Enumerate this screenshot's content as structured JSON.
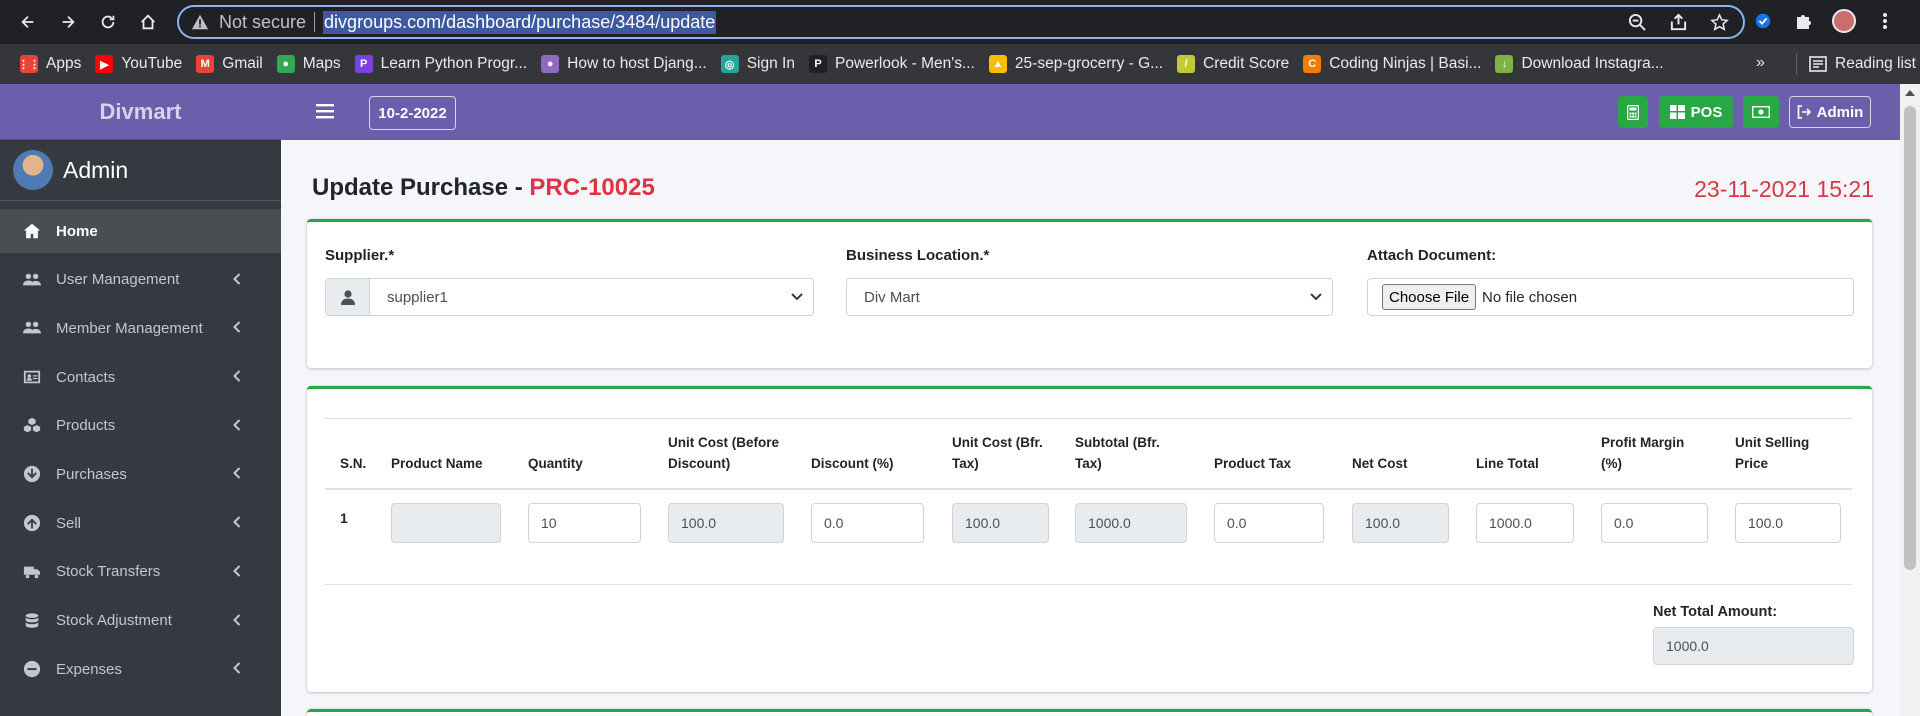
{
  "browser": {
    "not_secure": "Not secure",
    "url": "divgroups.com/dashboard/purchase/3484/update",
    "bookmarks": [
      {
        "label": "Apps",
        "icon": "apps-grid-icon",
        "color": "#ea4335"
      },
      {
        "label": "YouTube",
        "icon": "youtube-icon",
        "color": "#ff0000"
      },
      {
        "label": "Gmail",
        "icon": "gmail-icon",
        "color": "#ea4335"
      },
      {
        "label": "Maps",
        "icon": "maps-icon",
        "color": "#34a853"
      },
      {
        "label": "Learn Python Progr...",
        "icon": "python-site-icon",
        "color": "#7b3fe4"
      },
      {
        "label": "How to host Djang...",
        "icon": "avatar-site-icon",
        "color": "#8e6bbf"
      },
      {
        "label": "Sign In",
        "icon": "signin-site-icon",
        "color": "#26a69a"
      },
      {
        "label": "Powerlook - Men's...",
        "icon": "powerlook-icon",
        "color": "#202124"
      },
      {
        "label": "25-sep-grocerry - G...",
        "icon": "google-drive-icon",
        "color": "#fbbc04"
      },
      {
        "label": "Credit Score",
        "icon": "credit-score-icon",
        "color": "#c0ca33"
      },
      {
        "label": "Coding Ninjas | Basi...",
        "icon": "coding-ninjas-icon",
        "color": "#f57c00"
      },
      {
        "label": "Download Instagra...",
        "icon": "download-icon",
        "color": "#7cb342"
      }
    ],
    "more": "»",
    "reading_list": "Reading list"
  },
  "sidebar": {
    "brand": "Divmart",
    "user": "Admin",
    "items": [
      {
        "label": "Home",
        "icon": "home-icon",
        "active": true
      },
      {
        "label": "User Management",
        "icon": "users-icon"
      },
      {
        "label": "Member Management",
        "icon": "users-icon"
      },
      {
        "label": "Contacts",
        "icon": "address-card-icon"
      },
      {
        "label": "Products",
        "icon": "cubes-icon"
      },
      {
        "label": "Purchases",
        "icon": "arrow-circle-down-icon"
      },
      {
        "label": "Sell",
        "icon": "arrow-circle-up-icon"
      },
      {
        "label": "Stock Transfers",
        "icon": "truck-icon"
      },
      {
        "label": "Stock Adjustment",
        "icon": "database-icon"
      },
      {
        "label": "Expenses",
        "icon": "minus-circle-icon"
      }
    ]
  },
  "topbar": {
    "date": "10-2-2022",
    "pos_label": "POS",
    "admin_label": "Admin",
    "accent": "#6b5fab",
    "green": "#28a745"
  },
  "page": {
    "title": "Update Purchase - ",
    "ref": "PRC-10025",
    "datetime": "23-11-2021 15:21"
  },
  "form": {
    "supplier_label": "Supplier.*",
    "supplier_value": "supplier1",
    "location_label": "Business Location.*",
    "location_value": "Div Mart",
    "attach_label": "Attach Document:",
    "choose_file": "Choose File",
    "no_file": "No file chosen"
  },
  "table": {
    "headers": [
      {
        "l1": "S.N.",
        "l2": ""
      },
      {
        "l1": "Product Name",
        "l2": ""
      },
      {
        "l1": "Quantity",
        "l2": ""
      },
      {
        "l1": "Unit Cost (Before",
        "l2": "Discount)"
      },
      {
        "l1": "Discount (%)",
        "l2": ""
      },
      {
        "l1": "Unit Cost (Bfr.",
        "l2": "Tax)"
      },
      {
        "l1": "Subtotal (Bfr.",
        "l2": "Tax)"
      },
      {
        "l1": "Product Tax",
        "l2": ""
      },
      {
        "l1": "Net Cost",
        "l2": ""
      },
      {
        "l1": "Line Total",
        "l2": ""
      },
      {
        "l1": "Profit Margin",
        "l2": "(%)"
      },
      {
        "l1": "Unit Selling",
        "l2": "Price"
      }
    ],
    "row": {
      "sn": "1",
      "product_name": "",
      "quantity": "10",
      "unit_cost_before_discount": "100.0",
      "discount": "0.0",
      "unit_cost_bfr_tax": "100.0",
      "subtotal_bfr_tax": "1000.0",
      "product_tax": "0.0",
      "net_cost": "100.0",
      "line_total": "1000.0",
      "profit_margin": "0.0",
      "unit_selling_price": "100.0"
    },
    "net_total_label": "Net Total Amount:",
    "net_total_value": "1000.0"
  }
}
